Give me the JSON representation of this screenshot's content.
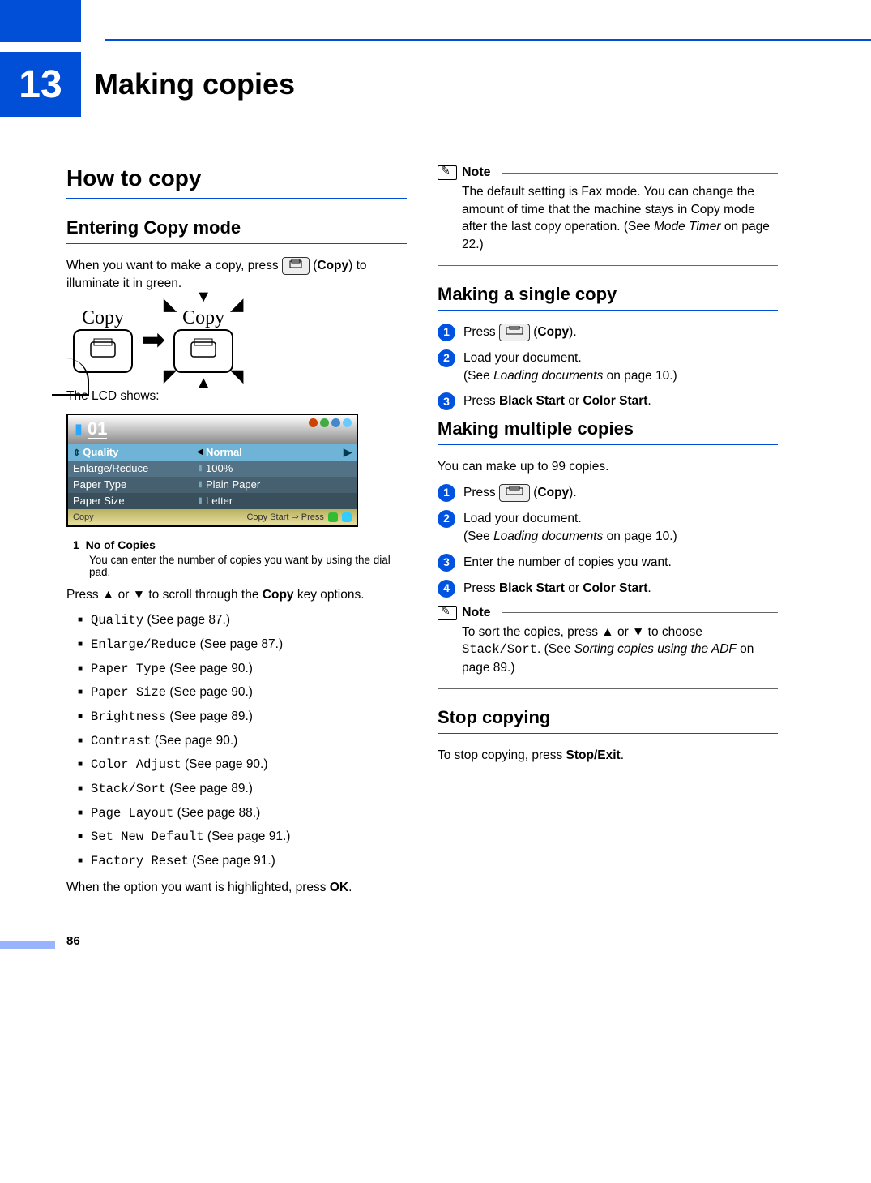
{
  "chapter": {
    "number": "13",
    "title": "Making copies"
  },
  "left": {
    "h2": "How to copy",
    "h3": "Entering Copy mode",
    "intro1": "When you want to make a copy, press ",
    "intro2_bold": "Copy",
    "intro3": ") to illuminate it in green.",
    "diagram": {
      "label": "Copy"
    },
    "lcd_intro": "The LCD shows:",
    "lcd": {
      "counter": "01",
      "rows": [
        {
          "key": "Quality",
          "val": "Normal"
        },
        {
          "key": "Enlarge/Reduce",
          "val": "100%"
        },
        {
          "key": "Paper Type",
          "val": "Plain Paper"
        },
        {
          "key": "Paper Size",
          "val": "Letter"
        }
      ],
      "footer_left": "Copy",
      "footer_right": "Copy Start ⇒ Press"
    },
    "def_num": "1",
    "def_title": "No of Copies",
    "def_text": "You can enter the number of copies you want by using the dial pad.",
    "scroll_p_1": "Press ",
    "scroll_p_2": " or ",
    "scroll_p_3": " to scroll through the ",
    "scroll_p_bold": "Copy",
    "scroll_p_4": " key options.",
    "options": [
      {
        "mono": "Quality",
        "tail": " (See page 87.)"
      },
      {
        "mono": "Enlarge/Reduce",
        "tail": " (See page 87.)"
      },
      {
        "mono": "Paper Type",
        "tail": " (See page 90.)"
      },
      {
        "mono": "Paper Size",
        "tail": " (See page 90.)"
      },
      {
        "mono": "Brightness",
        "tail": " (See page 89.)"
      },
      {
        "mono": "Contrast",
        "tail": " (See page 90.)"
      },
      {
        "mono": "Color Adjust",
        "tail": " (See page 90.)"
      },
      {
        "mono": "Stack/Sort",
        "tail": " (See page 89.)"
      },
      {
        "mono": "Page Layout",
        "tail": " (See page 88.)"
      },
      {
        "mono": "Set New Default",
        "tail": " (See page 91.)"
      },
      {
        "mono": "Factory Reset",
        "tail": " (See page 91.)"
      }
    ],
    "end_p1": "When the option you want is highlighted, press ",
    "end_bold": "OK",
    "end_p2": "."
  },
  "right": {
    "note1_title": "Note",
    "note1_body_a": "The default setting is Fax mode. You can change the amount of time that the machine stays in Copy mode after the last copy operation. (See ",
    "note1_body_i": "Mode Timer",
    "note1_body_b": " on page 22.)",
    "h3a": "Making a single copy",
    "stepsA": {
      "s1a": "Press ",
      "s1b": "Copy",
      "s1c": ").",
      "s2a": "Load your document.",
      "s2b": "(See ",
      "s2c_i": "Loading documents",
      "s2d": " on page 10.)",
      "s3a": "Press ",
      "s3b": "Black Start",
      "s3c": " or ",
      "s3d": "Color Start",
      "s3e": "."
    },
    "h3b": "Making multiple copies",
    "multi_intro": "You can make up to 99 copies.",
    "stepsB": {
      "s1a": "Press ",
      "s1b": "Copy",
      "s1c": ").",
      "s2a": "Load your document.",
      "s2b": "(See ",
      "s2c_i": "Loading documents",
      "s2d": " on page 10.)",
      "s3": "Enter the number of copies you want.",
      "s4a": "Press ",
      "s4b": "Black Start",
      "s4c": " or ",
      "s4d": "Color Start",
      "s4e": "."
    },
    "note2_title": "Note",
    "note2_a": "To sort the copies, press ▲ or ▼ to choose ",
    "note2_mono": "Stack/Sort",
    "note2_b": ". (See ",
    "note2_i": "Sorting copies using the ADF",
    "note2_c": " on page 89.)",
    "h3c": "Stop copying",
    "stop_a": "To stop copying, press ",
    "stop_b": "Stop/Exit",
    "stop_c": "."
  },
  "page_number": "86"
}
